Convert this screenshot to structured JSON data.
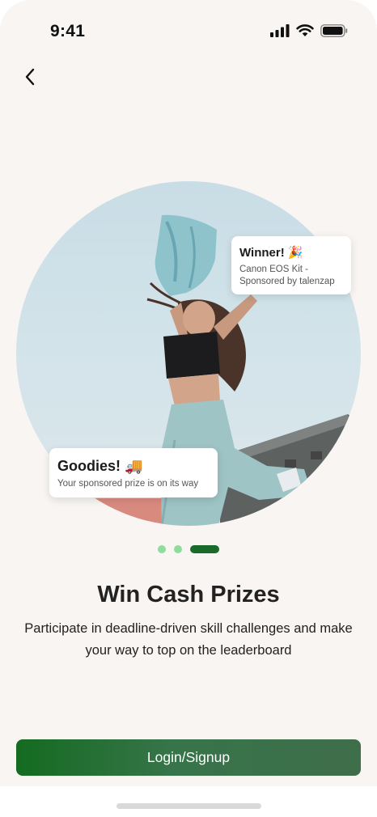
{
  "status_bar": {
    "time": "9:41"
  },
  "cards": {
    "winner": {
      "title": "Winner! 🎉",
      "text": "Canon EOS Kit - Sponsored by talenzap"
    },
    "goodies": {
      "title": "Goodies! 🚚",
      "text": "Your sponsored prize is on its way"
    }
  },
  "carousel": {
    "page_count": 3,
    "active_index": 2,
    "inactive_color": "#8fdc9c",
    "active_color": "#1a6a2a"
  },
  "content": {
    "headline": "Win Cash Prizes",
    "subtext": "Participate in deadline-driven skill challenges and make your way to top on the leaderboard"
  },
  "actions": {
    "login_label": "Login/Signup"
  },
  "colors": {
    "background": "#f8f5f2",
    "primary": "#1a6a2a",
    "text": "#222222"
  },
  "icons": [
    "back-arrow-icon",
    "signal-icon",
    "wifi-icon",
    "battery-icon"
  ]
}
